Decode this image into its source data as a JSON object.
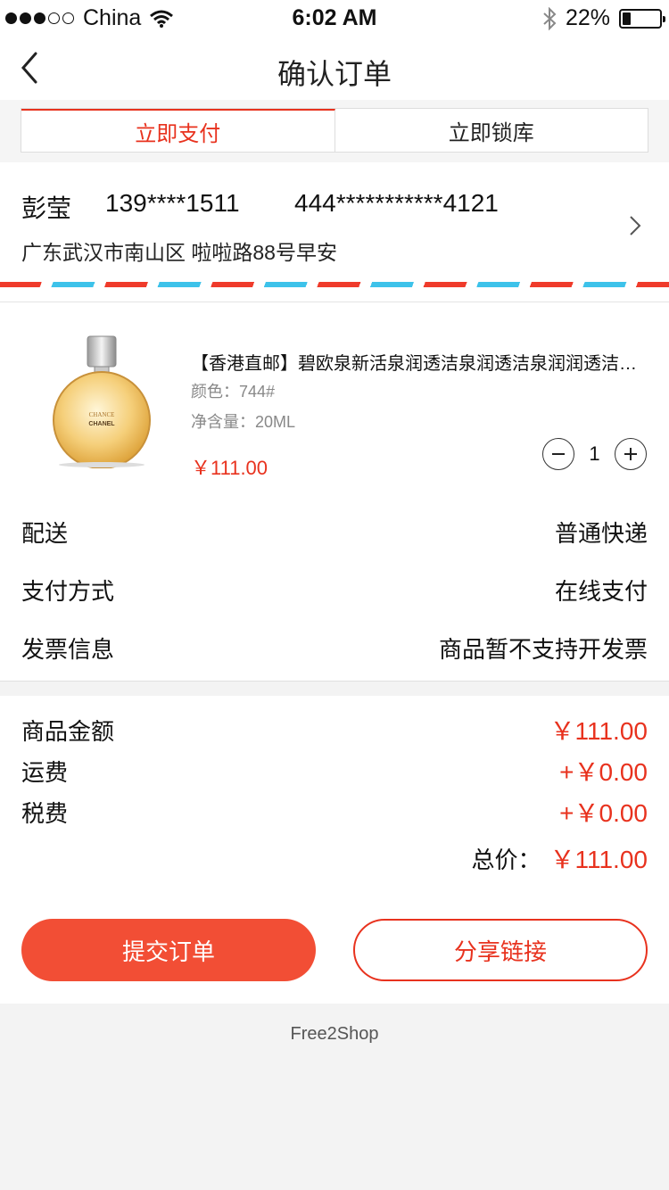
{
  "status_bar": {
    "carrier": "China",
    "time": "6:02 AM",
    "battery": "22%",
    "battery_level": 0.22,
    "signal_filled": 3,
    "signal_total": 5
  },
  "nav": {
    "title": "确认订单"
  },
  "tabs": [
    {
      "label": "立即支付",
      "active": true
    },
    {
      "label": "立即锁库",
      "active": false
    }
  ],
  "address": {
    "name": "彭莹",
    "phone": "139****1511",
    "id_number": "444***********4121",
    "detail": "广东武汉市南山区 啦啦路88号早安"
  },
  "product": {
    "title": "【香港直邮】碧欧泉新活泉润透洁泉润透洁泉润润透洁泉润透洁泉",
    "color": "颜色：744#",
    "volume": "净含量：20ML",
    "price": "￥111.00",
    "quantity": "1",
    "image_label": "CHANCE",
    "image_brand": "CHANEL"
  },
  "info_rows": [
    {
      "label": "配送",
      "value": "普通快递"
    },
    {
      "label": "支付方式",
      "value": "在线支付"
    },
    {
      "label": "发票信息",
      "value": "商品暂不支持开发票"
    }
  ],
  "totals": {
    "subtotal_label": "商品金额",
    "subtotal": "￥111.00",
    "shipping_label": "运费",
    "shipping": "+￥0.00",
    "tax_label": "税费",
    "tax": "+￥0.00",
    "grand_label": "总价：",
    "grand": "￥111.00"
  },
  "buttons": {
    "submit": "提交订单",
    "share": "分享链接"
  },
  "footer": "Free2Shop",
  "colors": {
    "accent": "#e8321e",
    "button_fill": "#f24e35",
    "airmail_red": "#ef3b2b",
    "airmail_blue": "#3dc2ea"
  }
}
